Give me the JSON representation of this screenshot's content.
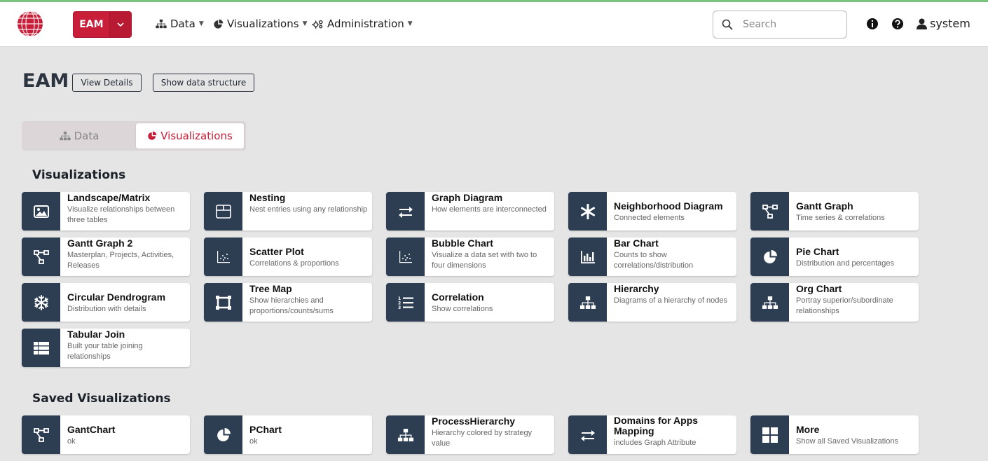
{
  "navbar": {
    "workspace_label": "EAM",
    "menus": [
      {
        "label": "Data",
        "icon": "sitemap-icon"
      },
      {
        "label": "Visualizations",
        "icon": "pie-chart-icon"
      },
      {
        "label": "Administration",
        "icon": "cogs-icon"
      }
    ],
    "search_placeholder": "Search",
    "user_name": "system",
    "accent_color": "#c81e3a"
  },
  "header": {
    "title": "EAM",
    "view_details_label": "View Details",
    "show_structure_label": "Show data structure"
  },
  "tabs": {
    "data_label": "Data",
    "visualizations_label": "Visualizations",
    "active": "Visualizations"
  },
  "visualizations": {
    "title": "Visualizations",
    "items": [
      {
        "title": "Landscape/Matrix",
        "desc": "Visualize relationships between three tables",
        "icon": "image-icon"
      },
      {
        "title": "Nesting",
        "desc": "Nest entries using any relationship",
        "icon": "box-icon"
      },
      {
        "title": "Graph Diagram",
        "desc": "How elements are interconnected",
        "icon": "exchange-icon"
      },
      {
        "title": "Neighborhood Diagram",
        "desc": "Connected elements",
        "icon": "asterisk-icon"
      },
      {
        "title": "Gantt Graph",
        "desc": "Time series & correlations",
        "icon": "flow-icon"
      },
      {
        "title": "Gantt Graph 2",
        "desc": "Masterplan, Projects, Activities, Releases",
        "icon": "flow-icon"
      },
      {
        "title": "Scatter Plot",
        "desc": "Correlations & proportions",
        "icon": "scatter-icon"
      },
      {
        "title": "Bubble Chart",
        "desc": "Visualize a data set with two to four dimensions",
        "icon": "scatter-icon"
      },
      {
        "title": "Bar Chart",
        "desc": "Counts to show correlations/distribution",
        "icon": "bar-chart-icon"
      },
      {
        "title": "Pie Chart",
        "desc": "Distribution and percentages",
        "icon": "pie-chart-icon"
      },
      {
        "title": "Circular Dendrogram",
        "desc": "Distribution with details",
        "icon": "snowflake-icon"
      },
      {
        "title": "Tree Map",
        "desc": "Show hierarchies and proportions/counts/sums",
        "icon": "treemap-icon"
      },
      {
        "title": "Correlation",
        "desc": "Show correlations",
        "icon": "list-ol-icon"
      },
      {
        "title": "Hierarchy",
        "desc": "Diagrams of a hierarchy of nodes",
        "icon": "sitemap-icon"
      },
      {
        "title": "Org Chart",
        "desc": "Portray superior/subordinate relationships",
        "icon": "sitemap-icon"
      },
      {
        "title": "Tabular Join",
        "desc": "Built your table joining relationships",
        "icon": "table-icon"
      }
    ]
  },
  "saved": {
    "title": "Saved Visualizations",
    "items": [
      {
        "title": "GantChart",
        "desc": "ok",
        "icon": "flow-icon"
      },
      {
        "title": "PChart",
        "desc": "ok",
        "icon": "pie-chart-icon"
      },
      {
        "title": "ProcessHierarchy",
        "desc": "Hierarchy colored by strategy value",
        "icon": "sitemap-icon"
      },
      {
        "title": "Domains for Apps Mapping",
        "desc": "includes Graph Attribute",
        "icon": "exchange-icon"
      },
      {
        "title": "More",
        "desc": "Show all Saved Visualizations",
        "icon": "grid-icon"
      }
    ]
  }
}
